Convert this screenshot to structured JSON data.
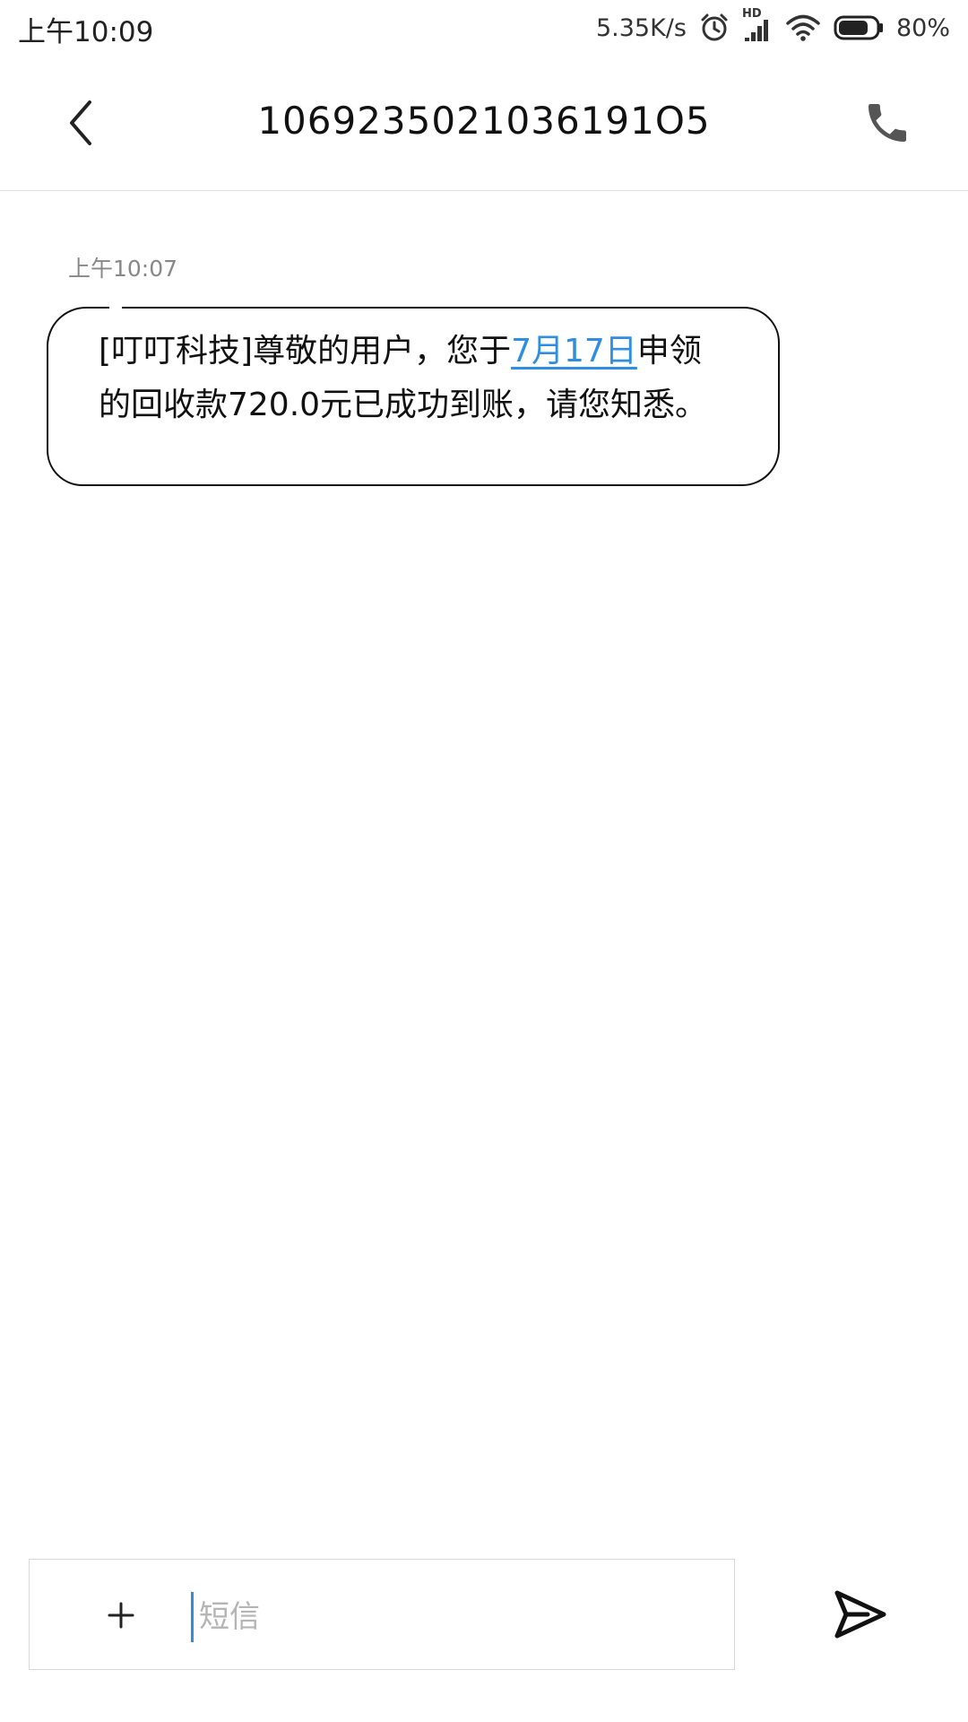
{
  "status_bar": {
    "time": "上午10:09",
    "network_speed": "5.35K/s",
    "signal_label": "HD",
    "battery_percent": "80%",
    "battery_level": 0.8,
    "icons": [
      "alarm-icon",
      "signal-icon",
      "wifi-icon",
      "battery-icon"
    ]
  },
  "header": {
    "title": "1069235021036191O5",
    "back_icon": "chevron-left-icon",
    "call_icon": "phone-icon"
  },
  "conversation": {
    "messages": [
      {
        "time": "上午10:07",
        "text_part1": "[叮叮科技]尊敬的用户，您于",
        "link_text": "7月17日",
        "text_part2": "申领的回收款720.0元已成功到账，请您知悉。"
      }
    ]
  },
  "composer": {
    "attach_icon": "plus-icon",
    "placeholder": "短信",
    "value": "",
    "send_icon": "send-icon"
  },
  "colors": {
    "link": "#2f8ee0",
    "text": "#111111",
    "muted": "#888888"
  }
}
